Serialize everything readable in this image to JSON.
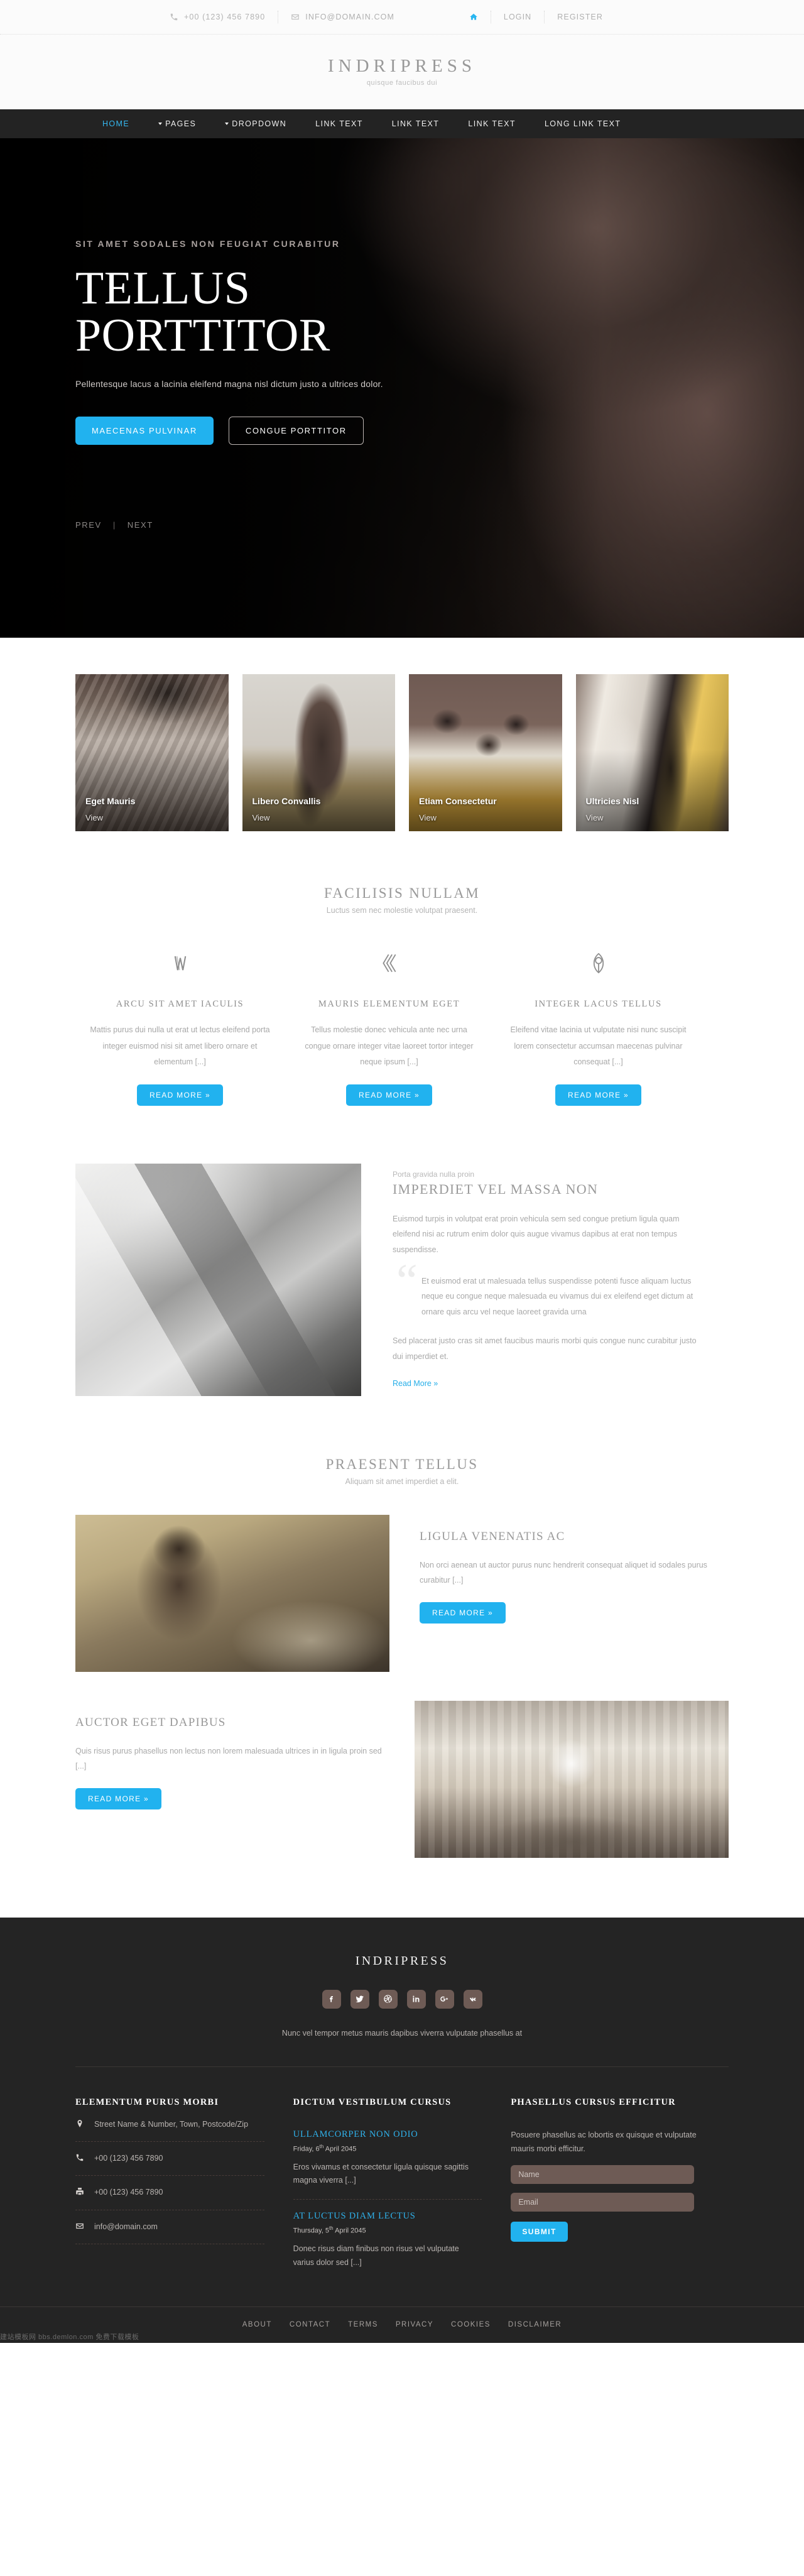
{
  "topbar": {
    "phone": "+00 (123) 456 7890",
    "email": "INFO@DOMAIN.COM",
    "login": "LOGIN",
    "register": "REGISTER"
  },
  "brand": {
    "name": "INDRIPRESS",
    "tagline": "quisque faucibus dui"
  },
  "nav": [
    {
      "label": "HOME",
      "active": true,
      "caret": false
    },
    {
      "label": "PAGES",
      "active": false,
      "caret": true
    },
    {
      "label": "DROPDOWN",
      "active": false,
      "caret": true
    },
    {
      "label": "LINK TEXT",
      "active": false,
      "caret": false
    },
    {
      "label": "LINK TEXT",
      "active": false,
      "caret": false
    },
    {
      "label": "LINK TEXT",
      "active": false,
      "caret": false
    },
    {
      "label": "LONG LINK TEXT",
      "active": false,
      "caret": false
    }
  ],
  "hero": {
    "kicker": "SIT AMET SODALES NON FEUGIAT CURABITUR",
    "title_line1": "TELLUS",
    "title_line2": "PORTTITOR",
    "desc": "Pellentesque lacus a lacinia eleifend magna nisl dictum justo a ultrices dolor.",
    "btn_primary": "MAECENAS PULVINAR",
    "btn_ghost": "CONGUE PORTTITOR",
    "prev": "PREV",
    "next": "NEXT",
    "separator": "|"
  },
  "gallery": [
    {
      "caption": "Eget Mauris",
      "view": "View"
    },
    {
      "caption": "Libero Convallis",
      "view": "View"
    },
    {
      "caption": "Etiam Consectetur",
      "view": "View"
    },
    {
      "caption": "Ultricies Nisl",
      "view": "View"
    }
  ],
  "features_head": {
    "title": "FACILISIS NULLAM",
    "sub": "Luctus sem nec molestie volutpat praesent."
  },
  "features": [
    {
      "title": "ARCU SIT AMET IACULIS",
      "text": "Mattis purus dui nulla ut erat ut lectus eleifend porta integer euismod nisi sit amet libero ornare et elementum [...]",
      "button": "READ MORE »"
    },
    {
      "title": "MAURIS ELEMENTUM EGET",
      "text": "Tellus molestie donec vehicula ante nec urna congue ornare integer vitae laoreet tortor integer neque ipsum [...]",
      "button": "READ MORE »"
    },
    {
      "title": "INTEGER LACUS TELLUS",
      "text": "Eleifend vitae lacinia ut vulputate nisi nunc suscipit lorem consectetur accumsan maecenas pulvinar consequat [...]",
      "button": "READ MORE »"
    }
  ],
  "media": {
    "kicker": "Porta gravida nulla proin",
    "title": "IMPERDIET VEL MASSA NON",
    "p1": "Euismod turpis in volutpat erat proin vehicula sem sed congue pretium ligula quam eleifend nisi ac rutrum enim dolor quis augue vivamus dapibus at erat non tempus suspendisse.",
    "quote": "Et euismod erat ut malesuada tellus suspendisse potenti fusce aliquam luctus neque eu congue neque malesuada eu vivamus dui ex eleifend eget dictum at ornare quis arcu vel neque laoreet gravida urna",
    "p2": "Sed placerat justo cras sit amet faucibus mauris morbi quis congue nunc curabitur justo dui imperdiet et.",
    "link": "Read More »"
  },
  "praesent_head": {
    "title": "PRAESENT TELLUS",
    "sub": "Aliquam sit amet imperdiet a elit."
  },
  "praesent": [
    {
      "title": "LIGULA VENENATIS AC",
      "text": "Non orci aenean ut auctor purus nunc hendrerit consequat aliquet id sodales purus curabitur [...]",
      "button": "READ MORE »"
    },
    {
      "title": "AUCTOR EGET DAPIBUS",
      "text": "Quis risus purus phasellus non lectus non lorem malesuada ultrices in in ligula proin sed [...]",
      "button": "READ MORE »"
    }
  ],
  "footer": {
    "brand": "INDRIPRESS",
    "note": "Nunc vel tempor metus mauris dapibus viverra vulputate phasellus at",
    "socials": [
      "facebook",
      "twitter",
      "dribbble",
      "linkedin",
      "google-plus",
      "vk"
    ],
    "col1": {
      "title": "ELEMENTUM PURUS MORBI",
      "address": "Street Name & Number, Town, Postcode/Zip",
      "phone": "+00 (123) 456 7890",
      "fax": "+00 (123) 456 7890",
      "email": "info@domain.com"
    },
    "col2": {
      "title": "DICTUM VESTIBULUM CURSUS",
      "posts": [
        {
          "title": "ULLAMCORPER NON ODIO",
          "day": "Friday, 6",
          "sup": "th",
          "date_rest": " April 2045",
          "excerpt": "Eros vivamus et consectetur ligula quisque sagittis magna viverra [...]"
        },
        {
          "title": "AT LUCTUS DIAM LECTUS",
          "day": "Thursday, 5",
          "sup": "th",
          "date_rest": " April 2045",
          "excerpt": "Donec risus diam finibus non risus vel vulputate varius dolor sed [...]"
        }
      ]
    },
    "col3": {
      "title": "PHASELLUS CURSUS EFFICITUR",
      "intro": "Posuere phasellus ac lobortis ex quisque et vulputate mauris morbi efficitur.",
      "name_placeholder": "Name",
      "email_placeholder": "Email",
      "submit": "SUBMIT"
    }
  },
  "bottombar": {
    "links": [
      "ABOUT",
      "CONTACT",
      "TERMS",
      "PRIVACY",
      "COOKIES",
      "DISCLAIMER"
    ],
    "watermark": "建站模板网 bbs.demlon.com 免费下载模板"
  }
}
